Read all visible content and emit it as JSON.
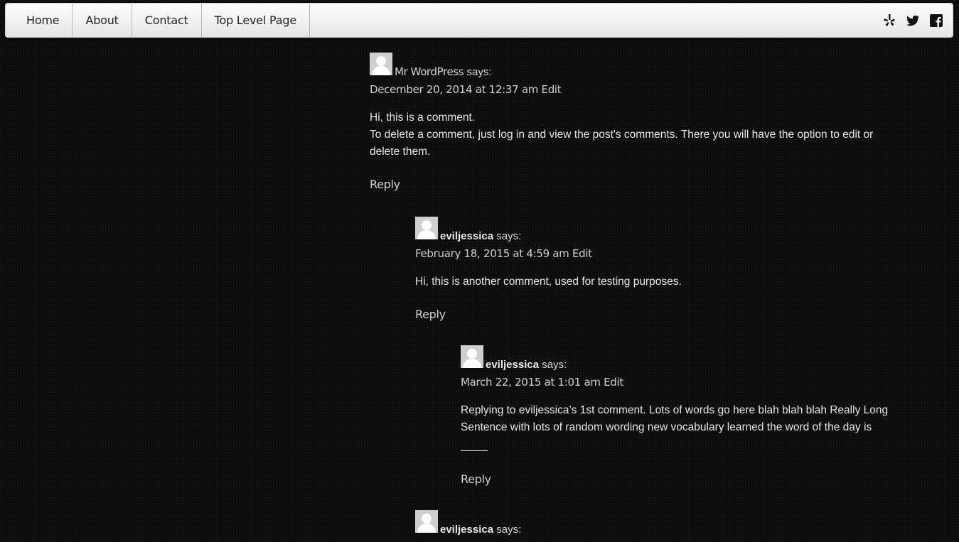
{
  "nav": {
    "items": [
      {
        "label": "Home"
      },
      {
        "label": "About"
      },
      {
        "label": "Contact"
      },
      {
        "label": "Top Level Page"
      }
    ],
    "social": [
      "yelp-icon",
      "twitter-icon",
      "facebook-icon"
    ]
  },
  "comments": [
    {
      "author": "Mr WordPress",
      "says": "says:",
      "date": "December 20, 2014 at 12:37 am",
      "edit": "Edit",
      "lines": [
        "Hi, this is a comment.",
        "To delete a comment, just log in and view the post's comments. There you will have the option to edit or delete them."
      ],
      "reply": "Reply"
    },
    {
      "author": "eviljessica",
      "says": "says:",
      "date": "February 18, 2015 at 4:59 am",
      "edit": "Edit",
      "lines": [
        "Hi, this is another comment, used for testing purposes."
      ],
      "reply": "Reply"
    },
    {
      "author": "eviljessica",
      "says": "says:",
      "date": "March 22, 2015 at 1:01 am",
      "edit": "Edit",
      "lines": [
        "Replying to eviljessica’s 1st comment. Lots of words go here blah blah blah Really Long Sentence with lots of random wording new vocabulary learned the word of the day is"
      ],
      "reply": "Reply"
    },
    {
      "author": "eviljessica",
      "says": "says:"
    }
  ],
  "colors": {
    "background": "#050505",
    "text": "#e6e6e6",
    "nav_bg": "#f2f2f2"
  }
}
